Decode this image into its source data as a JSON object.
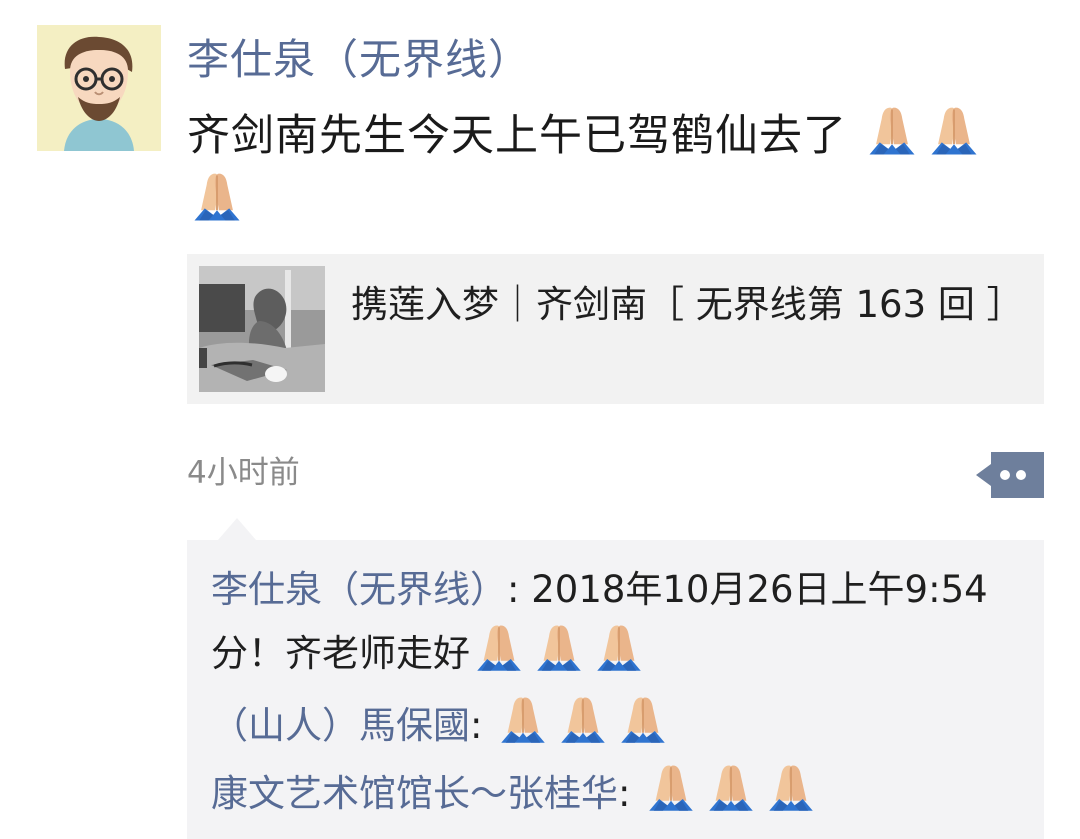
{
  "post": {
    "author": "李仕泉（无界线）",
    "text": "齐剑南先生今天上午已驾鹤仙去了",
    "text_emoji": [
      "folded-hands-icon",
      "folded-hands-icon",
      "folded-hands-icon"
    ],
    "link_card": {
      "title": "携莲入梦｜齐剑南［ 无界线第 163 回 ］"
    },
    "time": "4小时前",
    "more_icon": "more-dots-icon"
  },
  "comments": [
    {
      "name": "李仕泉（无界线）",
      "separator": ": ",
      "text": "2018年10月26日上午9:54分！齐老师走好",
      "emoji": [
        "folded-hands-icon",
        "folded-hands-icon",
        "folded-hands-icon"
      ]
    },
    {
      "name": "（山人）馬保國",
      "separator": ": ",
      "text": "",
      "emoji": [
        "folded-hands-icon",
        "folded-hands-icon",
        "folded-hands-icon"
      ]
    },
    {
      "name": "康文艺术馆馆长～张桂华",
      "separator": ": ",
      "text": "",
      "emoji": [
        "folded-hands-icon",
        "folded-hands-icon",
        "folded-hands-icon"
      ]
    }
  ],
  "colors": {
    "link_blue": "#576b95",
    "time_gray": "#8a8a8a",
    "card_bg": "#f2f2f2",
    "comments_bg": "#f3f3f5",
    "avatar_bg": "#f4efc3"
  }
}
